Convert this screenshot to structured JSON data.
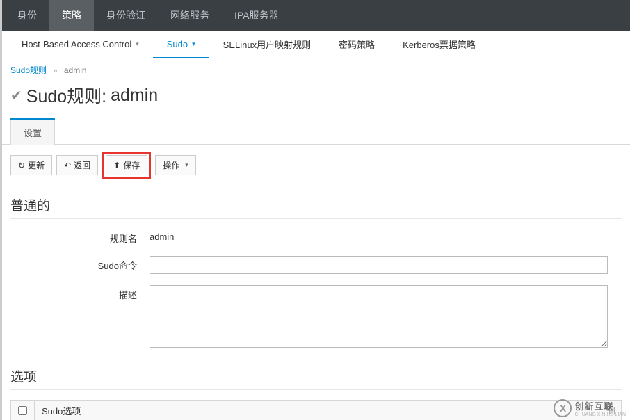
{
  "topnav": {
    "items": [
      "身份",
      "策略",
      "身份验证",
      "网络服务",
      "IPA服务器"
    ],
    "active_index": 1
  },
  "subnav": {
    "items": [
      {
        "label": "Host-Based Access Control",
        "dropdown": true
      },
      {
        "label": "Sudo",
        "dropdown": true,
        "active": true
      },
      {
        "label": "SELinux用户映射规则"
      },
      {
        "label": "密码策略"
      },
      {
        "label": "Kerberos票据策略"
      }
    ]
  },
  "breadcrumb": {
    "link": "Sudo规则",
    "sep": "»",
    "current": "admin"
  },
  "page_title": {
    "prefix": "Sudo规则:",
    "name": "admin"
  },
  "inner_tab": "设置",
  "toolbar": {
    "refresh": "更新",
    "back": "返回",
    "save": "保存",
    "actions": "操作"
  },
  "section_general": {
    "title": "普通的",
    "rule_name_label": "规则名",
    "rule_name_value": "admin",
    "sudo_cmd_label": "Sudo命令",
    "sudo_cmd_value": "",
    "description_label": "描述",
    "description_value": ""
  },
  "section_options": {
    "title": "选项",
    "col_header": "Sudo选项",
    "truncated_action": "删"
  },
  "watermark": {
    "logo_letter": "X",
    "line1": "创新互联",
    "line2": "CHUANG XIN HU LIAN"
  }
}
